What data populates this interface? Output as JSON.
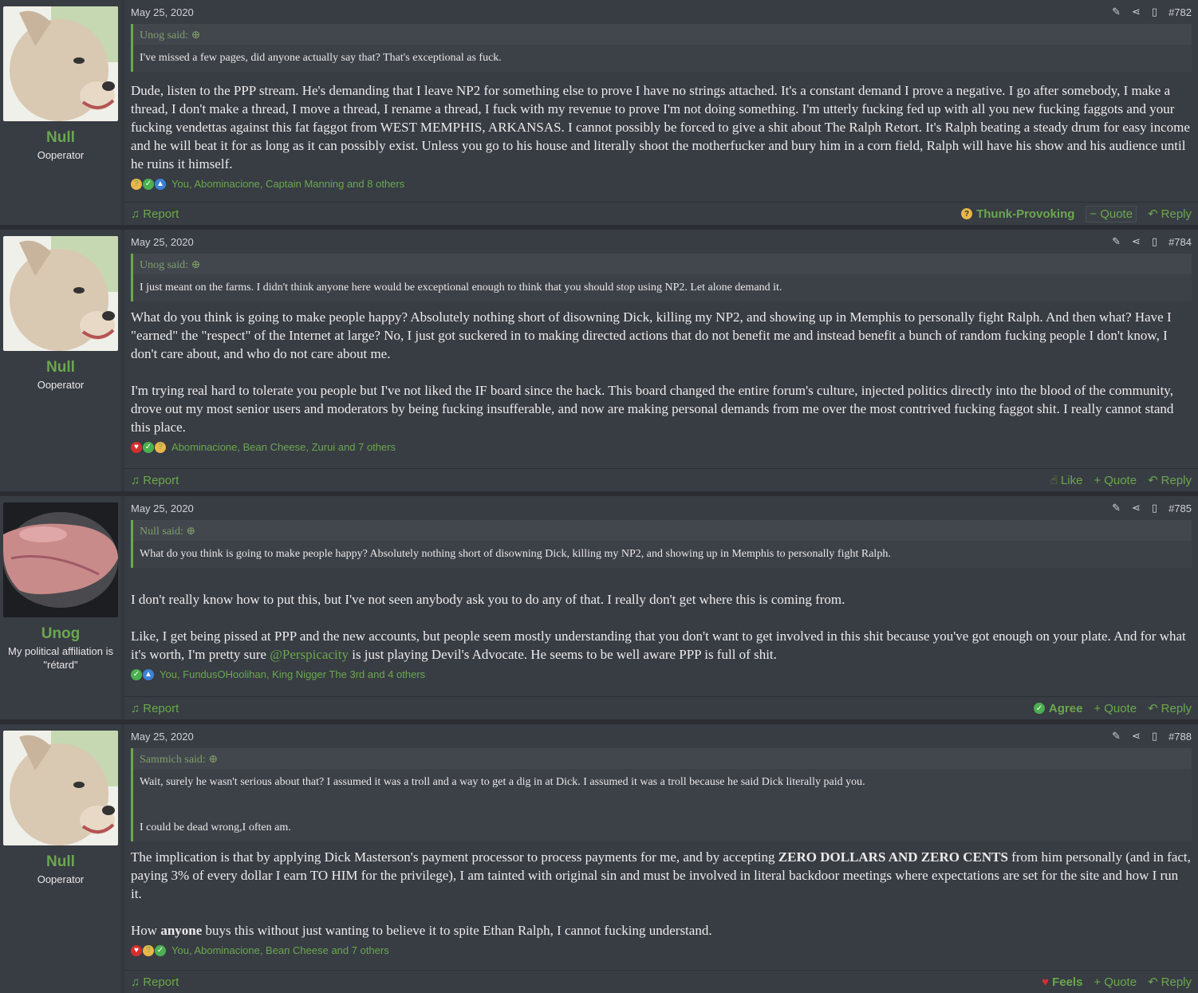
{
  "posts": [
    {
      "date": "May 25, 2020",
      "number": "#782",
      "username": "Null",
      "usertitle": "Ooperator",
      "quote_author": "Unog said:",
      "quote_lines": [
        "I've missed a few pages, did anyone actually say that? That's exceptional as fuck."
      ],
      "paragraphs": [
        "Dude, listen to the PPP stream. He's demanding that I leave NP2 for something else to prove I have no strings attached. It's a constant demand I prove a negative. I go after somebody, I make a thread, I don't make a thread, I move a thread, I rename a thread, I fuck with my revenue to prove I'm not doing something. I'm utterly fucking fed up with all you new fucking faggots and your fucking vendettas against this fat faggot from WEST MEMPHIS, ARKANSAS. I cannot possibly be forced to give a shit about The Ralph Retort. It's Ralph beating a steady drum for easy income and he will beat it for as long as it can possibly exist. Unless you go to his house and literally shoot the motherfucker and bury him in a corn field, Ralph will have his show and his audience until he ruins it himself."
      ],
      "reactions": "You, Abominacione, Captain Manning and 8 others",
      "report": "Report",
      "react_label": "Thunk-Provoking",
      "quote_label": "Quote",
      "reply_label": "Reply"
    },
    {
      "date": "May 25, 2020",
      "number": "#784",
      "username": "Null",
      "usertitle": "Ooperator",
      "quote_author": "Unog said:",
      "quote_lines": [
        "I just meant on the farms. I didn't think anyone here would be exceptional enough to think that you should stop using NP2. Let alone demand it."
      ],
      "paragraphs": [
        "What do you think is going to make people happy? Absolutely nothing short of disowning Dick, killing my NP2, and showing up in Memphis to personally fight Ralph. And then what? Have I \"earned\" the \"respect\" of the Internet at large? No, I just got suckered in to making directed actions that do not benefit me and instead benefit a bunch of random fucking people I don't know, I don't care about, and who do not care about me.",
        "I'm trying real hard to tolerate you people but I've not liked the IF board since the hack. This board changed the entire forum's culture, injected politics directly into the blood of the community, drove out my most senior users and moderators by being fucking insufferable, and now are making personal demands from me over the most contrived fucking faggot shit. I really cannot stand this place."
      ],
      "reactions": "Abominacione, Bean Cheese, Zurui and 7 others",
      "report": "Report",
      "react_label": "Like",
      "quote_label": "Quote",
      "reply_label": "Reply"
    },
    {
      "date": "May 25, 2020",
      "number": "#785",
      "username": "Unog",
      "usertitle": "My political affiliation is \"rétard\"",
      "quote_author": "Null said:",
      "quote_lines": [
        "What do you think is going to make people happy? Absolutely nothing short of disowning Dick, killing my NP2, and showing up in Memphis to personally fight Ralph."
      ],
      "paragraph1": "I don't really know how to put this, but I've not seen anybody ask you to do any of that. I really don't get where this is coming from.",
      "paragraph2_pre": "Like, I get being pissed at PPP and the new accounts, but people seem mostly understanding that you don't want to get involved in this shit because you've got enough on your plate. And for what it's worth, I'm pretty sure ",
      "mention": "@Perspicacity",
      "paragraph2_post": " is just playing Devil's Advocate. He seems to be well aware PPP is full of shit.",
      "reactions": "You, FundusOHoolihan, King Nigger The 3rd and 4 others",
      "report": "Report",
      "react_label": "Agree",
      "quote_label": "Quote",
      "reply_label": "Reply"
    },
    {
      "date": "May 25, 2020",
      "number": "#788",
      "username": "Null",
      "usertitle": "Ooperator",
      "quote_author": "Sammich said:",
      "quote_lines": [
        "Wait, surely he wasn't serious about that? I assumed it was a troll and a way to get a dig in at Dick. I assumed it was a troll because he said Dick literally paid you.",
        "I could be dead wrong,I often am."
      ],
      "p1_pre": "The implication is that by applying Dick Masterson's payment processor to process payments for me, and by accepting ",
      "p1_bold": "ZERO DOLLARS AND ZERO CENTS",
      "p1_post": " from him personally (and in fact, paying 3% of every dollar I earn TO HIM for the privilege), I am tainted with original sin and must be involved in literal backdoor meetings where expectations are set for the site and how I run it.",
      "p2_pre": "How ",
      "p2_bold": "anyone",
      "p2_post": " buys this without just wanting to believe it to spite Ethan Ralph, I cannot fucking understand.",
      "reactions": "You, Abominacione, Bean Cheese and 7 others",
      "report": "Report",
      "react_label": "Feels",
      "quote_label": "Quote",
      "reply_label": "Reply"
    }
  ],
  "icons": [
    "edit-icon",
    "share-icon",
    "bookmark-icon",
    "bell-icon",
    "minus-icon",
    "plus-icon",
    "reply-icon",
    "thumbs-up-icon"
  ],
  "colors": {
    "accent": "#6aa84f",
    "background": "#2a2d32",
    "panel": "#383c43"
  }
}
